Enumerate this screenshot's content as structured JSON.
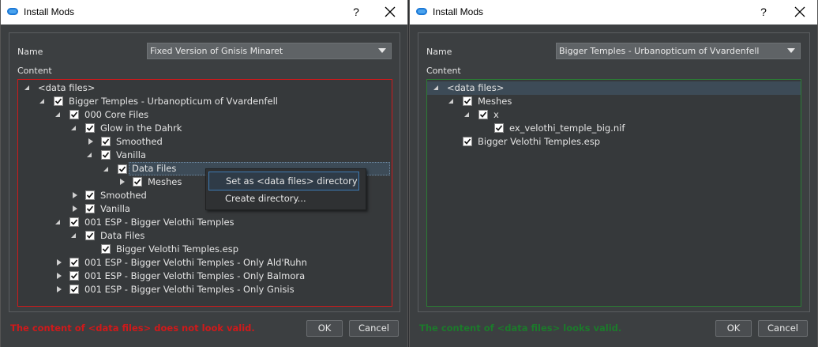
{
  "left": {
    "window_title": "Install Mods",
    "help": "?",
    "name_label": "Name",
    "name_value": "Fixed Version of Gnisis Minaret",
    "content_label": "Content",
    "tree": [
      {
        "label": "<data files>",
        "checkbox": false,
        "expander": "open"
      },
      {
        "label": "Bigger Temples - Urbanopticum of Vvardenfell",
        "checkbox": true,
        "expander": "open"
      },
      {
        "label": "000 Core Files",
        "checkbox": true,
        "expander": "open"
      },
      {
        "label": "Glow in the Dahrk",
        "checkbox": true,
        "expander": "open"
      },
      {
        "label": "Smoothed",
        "checkbox": true,
        "expander": "closed"
      },
      {
        "label": "Vanilla",
        "checkbox": true,
        "expander": "open"
      },
      {
        "label": "Data Files",
        "checkbox": true,
        "expander": "open"
      },
      {
        "label": "Meshes",
        "checkbox": true,
        "expander": "closed"
      },
      {
        "label": "Smoothed",
        "checkbox": true,
        "expander": "closed"
      },
      {
        "label": "Vanilla",
        "checkbox": true,
        "expander": "closed"
      },
      {
        "label": "001 ESP - Bigger Velothi Temples",
        "checkbox": true,
        "expander": "open"
      },
      {
        "label": "Data Files",
        "checkbox": true,
        "expander": "open"
      },
      {
        "label": "Bigger Velothi Temples.esp",
        "checkbox": true,
        "expander": "none"
      },
      {
        "label": "001 ESP - Bigger Velothi Temples - Only Ald'Ruhn",
        "checkbox": true,
        "expander": "closed"
      },
      {
        "label": "001 ESP - Bigger Velothi Temples - Only Balmora",
        "checkbox": true,
        "expander": "closed"
      },
      {
        "label": "001 ESP - Bigger Velothi Temples - Only Gnisis",
        "checkbox": true,
        "expander": "closed"
      }
    ],
    "context_menu": [
      "Set as <data files> directory",
      "Create directory..."
    ],
    "status": "The content of <data files> does not look valid.",
    "status_color": "#d0191a",
    "ok": "OK",
    "cancel": "Cancel"
  },
  "right": {
    "window_title": "Install Mods",
    "help": "?",
    "name_label": "Name",
    "name_value": "Bigger Temples - Urbanopticum of Vvardenfell",
    "content_label": "Content",
    "tree": [
      {
        "label": "<data files>",
        "checkbox": false,
        "expander": "open"
      },
      {
        "label": "Meshes",
        "checkbox": true,
        "expander": "open"
      },
      {
        "label": "x",
        "checkbox": true,
        "expander": "open"
      },
      {
        "label": "ex_velothi_temple_big.nif",
        "checkbox": true,
        "expander": "none"
      },
      {
        "label": "Bigger Velothi Temples.esp",
        "checkbox": true,
        "expander": "none"
      }
    ],
    "status": "The content of <data files> looks valid.",
    "status_color": "#1c7a2b",
    "ok": "OK",
    "cancel": "Cancel"
  }
}
